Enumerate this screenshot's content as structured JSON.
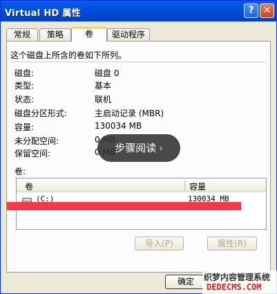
{
  "window": {
    "title": "Virtual HD 属性",
    "help_glyph": "?",
    "close_glyph": "✕"
  },
  "tabs": [
    {
      "label": "常规"
    },
    {
      "label": "策略"
    },
    {
      "label": "卷",
      "active": true
    },
    {
      "label": "驱动程序"
    }
  ],
  "panel": {
    "description": "这个磁盘上所含的卷如下所列。",
    "properties": [
      {
        "label": "磁盘:",
        "value": "磁盘 0"
      },
      {
        "label": "类型:",
        "value": "基本"
      },
      {
        "label": "状态:",
        "value": "联机"
      },
      {
        "label": "磁盘分区形式:",
        "value": "主启动记录 (MBR)"
      },
      {
        "label": "容量:",
        "value": "130034 MB"
      },
      {
        "label": "未分配空间:",
        "value": "0 MB"
      },
      {
        "label": "保留空间:",
        "value": "0 MB"
      }
    ],
    "volumes_label": "卷:",
    "columns": {
      "volume": "卷",
      "capacity": "容量"
    },
    "rows": [
      {
        "volume": "(C:)",
        "capacity": "130034 MB"
      }
    ],
    "import_button": "导入(P)",
    "properties_button": "属性(R)"
  },
  "overlay": {
    "label": "步骤阅读",
    "chevron": "›"
  },
  "footer": {
    "ok_button": "确定"
  },
  "watermark": {
    "line1": "织梦内容管理系统",
    "line2": "DEDECMS.COM"
  },
  "colors": {
    "title_bar": "#0054e3",
    "tab_highlight": "#ffc83c",
    "redaction": "#f23b49"
  }
}
